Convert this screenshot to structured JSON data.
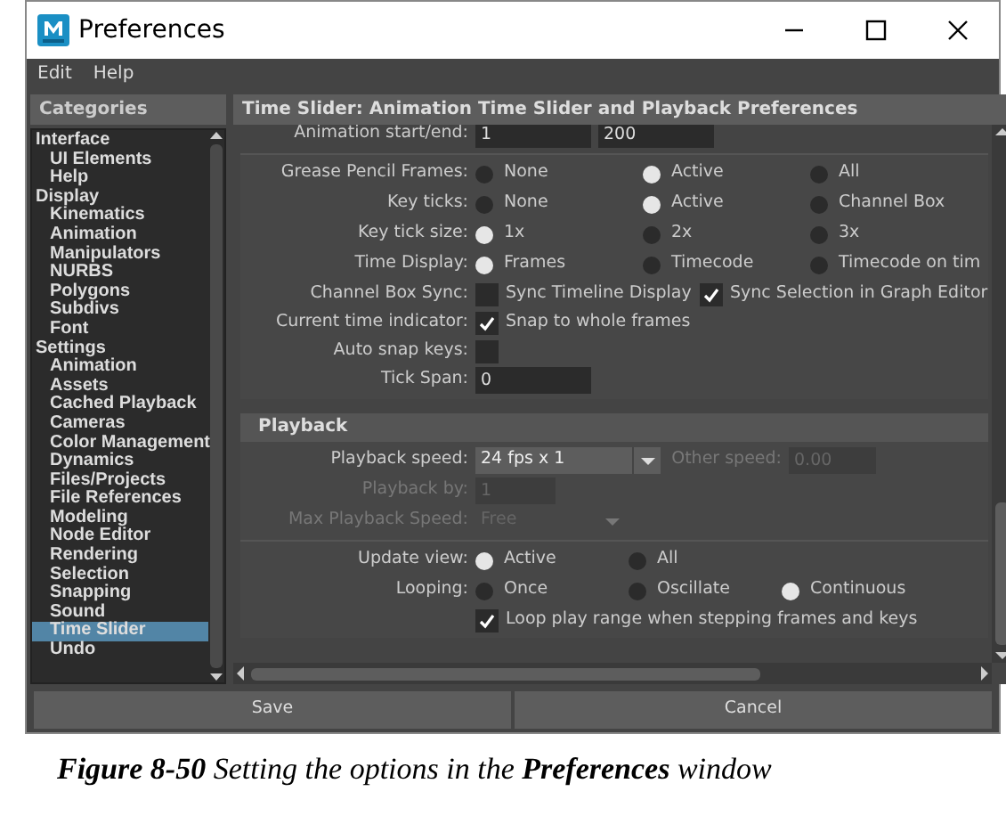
{
  "window": {
    "title": "Preferences"
  },
  "menu": [
    "Edit",
    "Help"
  ],
  "sidebar": {
    "title": "Categories",
    "items": [
      {
        "label": "Interface",
        "selected": false,
        "children": [
          {
            "label": "UI Elements",
            "selected": false
          },
          {
            "label": "Help",
            "selected": false
          }
        ]
      },
      {
        "label": "Display",
        "selected": false,
        "children": [
          {
            "label": "Kinematics",
            "selected": false
          },
          {
            "label": "Animation",
            "selected": false
          },
          {
            "label": "Manipulators",
            "selected": false
          },
          {
            "label": "NURBS",
            "selected": false
          },
          {
            "label": "Polygons",
            "selected": false
          },
          {
            "label": "Subdivs",
            "selected": false
          },
          {
            "label": "Font",
            "selected": false
          }
        ]
      },
      {
        "label": "Settings",
        "selected": false,
        "children": [
          {
            "label": "Animation",
            "selected": false
          },
          {
            "label": "Assets",
            "selected": false
          },
          {
            "label": "Cached Playback",
            "selected": false
          },
          {
            "label": "Cameras",
            "selected": false
          },
          {
            "label": "Color Management",
            "selected": false
          },
          {
            "label": "Dynamics",
            "selected": false
          },
          {
            "label": "Files/Projects",
            "selected": false
          },
          {
            "label": "File References",
            "selected": false
          },
          {
            "label": "Modeling",
            "selected": false
          },
          {
            "label": "Node Editor",
            "selected": false
          },
          {
            "label": "Rendering",
            "selected": false
          },
          {
            "label": "Selection",
            "selected": false
          },
          {
            "label": "Snapping",
            "selected": false
          },
          {
            "label": "Sound",
            "selected": false
          },
          {
            "label": "Time Slider",
            "selected": true
          },
          {
            "label": "Undo",
            "selected": false
          }
        ]
      }
    ]
  },
  "panel": {
    "title": "Time Slider: Animation Time Slider and Playback Preferences"
  },
  "sections": [
    {
      "groups": [
        [
          {
            "kind": "fields",
            "label": "Animation start/end:",
            "values": [
              "1",
              "200"
            ]
          }
        ],
        [
          {
            "kind": "radio",
            "label": "Grease Pencil Frames:",
            "options": [
              {
                "label": "None",
                "selected": false
              },
              {
                "label": "Active",
                "selected": true
              },
              {
                "label": "All",
                "selected": false
              }
            ]
          },
          {
            "kind": "radio",
            "label": "Key ticks:",
            "options": [
              {
                "label": "None",
                "selected": false
              },
              {
                "label": "Active",
                "selected": true
              },
              {
                "label": "Channel Box",
                "selected": false
              }
            ]
          },
          {
            "kind": "radio",
            "label": "Key tick size:",
            "options": [
              {
                "label": "1x",
                "selected": true
              },
              {
                "label": "2x",
                "selected": false
              },
              {
                "label": "3x",
                "selected": false
              }
            ]
          },
          {
            "kind": "radio",
            "label": "Time Display:",
            "options": [
              {
                "label": "Frames",
                "selected": true
              },
              {
                "label": "Timecode",
                "selected": false
              },
              {
                "label": "Timecode on tim",
                "selected": false
              }
            ]
          },
          {
            "kind": "checks",
            "label": "Channel Box Sync:",
            "options": [
              {
                "label": "Sync Timeline Display",
                "checked": false
              },
              {
                "label": "Sync Selection in Graph Editor",
                "checked": true
              }
            ]
          },
          {
            "kind": "checks",
            "label": "Current time indicator:",
            "options": [
              {
                "label": "Snap to whole frames",
                "checked": true
              }
            ]
          },
          {
            "kind": "checks",
            "label": "Auto snap keys:",
            "options": [
              {
                "checked": false
              }
            ]
          },
          {
            "kind": "fields",
            "label": "Tick Span:",
            "values": [
              "0"
            ]
          }
        ]
      ]
    },
    {
      "title": "Playback",
      "groups": [
        [
          {
            "kind": "dropdown",
            "label": "Playback speed:",
            "value": "24 fps x 1",
            "disabled": false,
            "extra": {
              "label": "Other speed:",
              "value": "0.00",
              "disabled": true
            }
          },
          {
            "kind": "field",
            "label": "Playback by:",
            "value": "1",
            "disabled": true
          },
          {
            "kind": "dropdown",
            "label": "Max Playback Speed:",
            "value": "Free",
            "disabled": true
          }
        ],
        [
          {
            "kind": "radio",
            "label": "Update view:",
            "options": [
              {
                "label": "Active",
                "selected": true
              },
              {
                "label": "All",
                "selected": false
              }
            ]
          },
          {
            "kind": "radio",
            "label": "Looping:",
            "options": [
              {
                "label": "Once",
                "selected": false
              },
              {
                "label": "Oscillate",
                "selected": false
              },
              {
                "label": "Continuous",
                "selected": true
              }
            ]
          },
          {
            "kind": "checks",
            "options": [
              {
                "label": "Loop play range when stepping frames and keys",
                "checked": true
              }
            ]
          }
        ]
      ]
    }
  ],
  "buttons": [
    "Save",
    "Cancel"
  ],
  "caption": "**Figure 8-50**  Setting the options in the **Preferences** window"
}
